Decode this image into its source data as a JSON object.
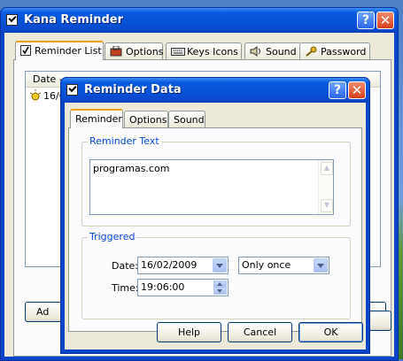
{
  "main_window": {
    "title": "Kana Reminder",
    "tabs": [
      {
        "label": "Reminder List",
        "icon": "checkbox-icon"
      },
      {
        "label": "Options",
        "icon": "toolbox-icon"
      },
      {
        "label": "Keys Icons",
        "icon": "keyboard-icon"
      },
      {
        "label": "Sound",
        "icon": "speaker-icon"
      },
      {
        "label": "Password",
        "icon": "key-icon"
      }
    ],
    "list_header": "Date -",
    "list_item_date": "16/0",
    "add_button_partial": "Ad"
  },
  "dialog": {
    "title": "Reminder Data",
    "tabs": [
      {
        "label": "Reminder"
      },
      {
        "label": "Options"
      },
      {
        "label": "Sound"
      }
    ],
    "reminder_text_group": "Reminder Text",
    "reminder_text": "programas.com",
    "triggered_group": "Triggered",
    "date_label": "Date:",
    "date_value": "16/02/2009",
    "frequency_value": "Only once",
    "time_label": "Time:",
    "time_value": "19:06:00",
    "buttons": {
      "help": "Help",
      "cancel": "Cancel",
      "ok": "OK"
    }
  },
  "colors": {
    "titlebar_blue": "#0553d6",
    "tab_highlight": "#e8a010",
    "group_label": "#0046d5"
  }
}
